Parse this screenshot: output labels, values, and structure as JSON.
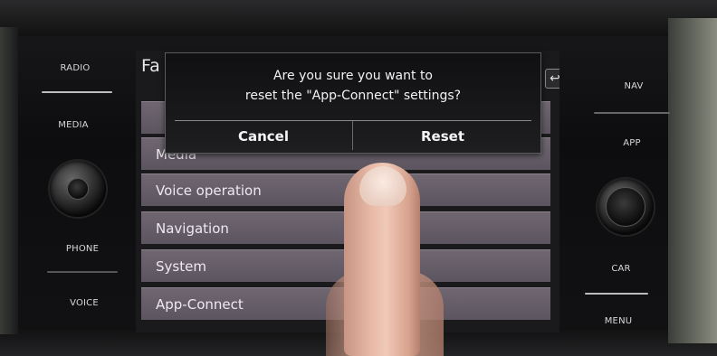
{
  "hardware_left": {
    "radio_label": "RADIO",
    "media_label": "MEDIA",
    "phone_label": "PHONE",
    "voice_label": "VOICE"
  },
  "hardware_right": {
    "nav_label": "NAV",
    "app_label": "APP",
    "car_label": "CAR",
    "menu_label": "MENU"
  },
  "screen": {
    "title": "Fa",
    "back_icon": "↩",
    "list_items": [
      {
        "label": ""
      },
      {
        "label": "Media"
      },
      {
        "label": "Voice operation"
      },
      {
        "label": "Navigation"
      },
      {
        "label": "System"
      },
      {
        "label": "App-Connect"
      }
    ]
  },
  "dialog": {
    "message_line1": "Are you sure you want to",
    "message_line2": "reset the \"App-Connect\" settings?",
    "cancel_label": "Cancel",
    "reset_label": "Reset"
  }
}
